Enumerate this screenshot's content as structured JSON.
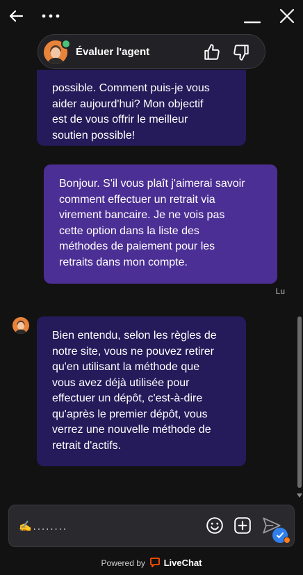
{
  "header": {
    "back_icon": "arrow-left-icon",
    "menu_icon": "more-dots-icon",
    "minimize_icon": "minimize-icon",
    "close_icon": "close-icon"
  },
  "agent_bar": {
    "title": "Évaluer l'agent",
    "online_color": "#4cc17a",
    "thumbs_up_icon": "thumbs-up-icon",
    "thumbs_down_icon": "thumbs-down-icon"
  },
  "messages": [
    {
      "sender": "agent",
      "lines": [
        "possible. Comment puis-je vous",
        "aider aujourd'hui? Mon objectif",
        "est de vous offrir le meilleur",
        "soutien possible!"
      ]
    },
    {
      "sender": "user",
      "lines": [
        "Bonjour. S'il vous plaît j'aimerai savoir",
        "comment effectuer un retrait via",
        "virement bancaire. Je ne vois pas",
        "cette option dans la liste des",
        "méthodes de paiement pour les",
        "retraits dans mon compte."
      ],
      "status": "Lu"
    },
    {
      "sender": "agent",
      "lines": [
        "Bien entendu, selon les règles de",
        "notre site, vous ne pouvez retirer",
        "qu'en utilisant la méthode que",
        "vous avez déjà utilisée pour",
        "effectuer un dépôt, c'est-à-dire",
        "qu'après le premier dépôt, vous",
        "verrez une nouvelle méthode de",
        "retrait d'actifs."
      ]
    }
  ],
  "composer": {
    "typing_text": "✍........",
    "emoji_icon": "emoji-icon",
    "attach_icon": "plus-square-icon",
    "send_icon": "send-icon"
  },
  "footer": {
    "prefix": "Powered by",
    "brand": "LiveChat"
  },
  "colors": {
    "background": "#121212",
    "agent_bubble": "#251a5a",
    "user_bubble": "#4c2f94",
    "brand_red": "#ff5100",
    "send_badge": "#2f80ed"
  }
}
